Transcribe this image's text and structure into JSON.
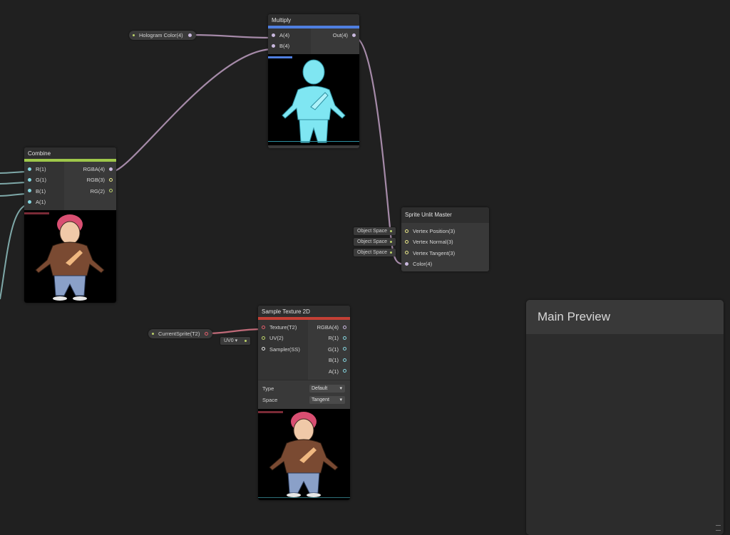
{
  "colors": {
    "background": "#202020",
    "node_body": "#393939",
    "node_title": "#2e2e2e",
    "wire_color4": "#a58aa8",
    "wire_float": "#7ea8a8",
    "wire_texture": "#c06a78",
    "accent_multiply": "#4f7fe0",
    "accent_combine": "#9fc84a",
    "accent_sample": "#c44035",
    "port_vector4": "#c9b8de",
    "port_vector3": "#ecea8a",
    "port_float": "#86d6e0",
    "port_texture": "#e05c6a",
    "port_uv": "#bcd36a",
    "port_sampler": "#e6e6e6"
  },
  "nodes": {
    "multiply": {
      "title": "Multiply",
      "inputs": [
        "A(4)",
        "B(4)"
      ],
      "outputs": [
        "Out(4)"
      ]
    },
    "combine": {
      "title": "Combine",
      "inputs": [
        "R(1)",
        "G(1)",
        "B(1)",
        "A(1)"
      ],
      "outputs": [
        "RGBA(4)",
        "RGB(3)",
        "RG(2)"
      ]
    },
    "sprite_master": {
      "title": "Sprite Unlit Master",
      "inputs": [
        "Vertex Position(3)",
        "Vertex Normal(3)",
        "Vertex Tangent(3)",
        "Color(4)"
      ],
      "space_slots": [
        "Object Space",
        "Object Space",
        "Object Space"
      ]
    },
    "sample_texture": {
      "title": "Sample Texture 2D",
      "inputs": [
        "Texture(T2)",
        "UV(2)",
        "Sampler(SS)"
      ],
      "outputs": [
        "RGBA(4)",
        "R(1)",
        "G(1)",
        "B(1)",
        "A(1)"
      ],
      "uv_slot": "UV0",
      "settings": {
        "type_label": "Type",
        "type_value": "Default",
        "space_label": "Space",
        "space_value": "Tangent"
      }
    }
  },
  "properties": {
    "hologram_color": "Hologram Color(4)",
    "current_sprite": "CurrentSprite(T2)"
  },
  "main_preview": {
    "title": "Main Preview"
  },
  "icons": {
    "character": "character-sprite-icon",
    "port": "port-dot-icon",
    "dropdown": "chevron-down-icon"
  }
}
